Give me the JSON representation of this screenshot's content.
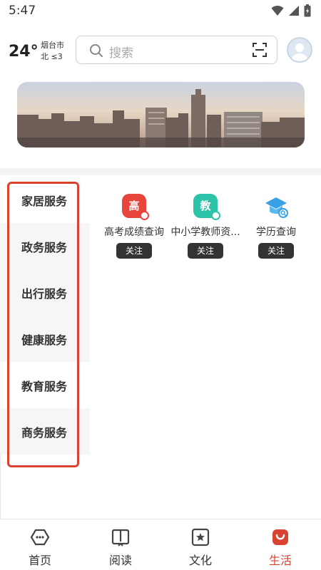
{
  "status_bar": {
    "time": "5:47"
  },
  "header": {
    "temperature": "24°",
    "city": "烟台市",
    "wind": "北 ≤3",
    "search_placeholder": "搜索"
  },
  "categories": [
    {
      "label": "家居服务"
    },
    {
      "label": "政务服务"
    },
    {
      "label": "出行服务"
    },
    {
      "label": "健康服务"
    },
    {
      "label": "教育服务"
    },
    {
      "label": "商务服务"
    }
  ],
  "services": [
    {
      "icon_char": "高",
      "icon": "exam-score-icon",
      "color": "#e8453c",
      "name": "高考成绩查询",
      "follow": "关注"
    },
    {
      "icon_char": "教",
      "icon": "teacher-qualification-icon",
      "color": "#2cc3a8",
      "name": "中小学教师资...",
      "follow": "关注"
    },
    {
      "icon_char": "",
      "icon": "graduation-cap-icon",
      "color": "#3aa0e6",
      "name": "学历查询",
      "follow": "关注"
    }
  ],
  "bottom_nav": [
    {
      "label": "首页",
      "icon": "home-icon"
    },
    {
      "label": "阅读",
      "icon": "book-icon"
    },
    {
      "label": "文化",
      "icon": "culture-star-icon"
    },
    {
      "label": "生活",
      "icon": "life-bag-icon",
      "active": true
    }
  ],
  "colors": {
    "accent": "#d9432f",
    "button_dark": "#333333"
  }
}
